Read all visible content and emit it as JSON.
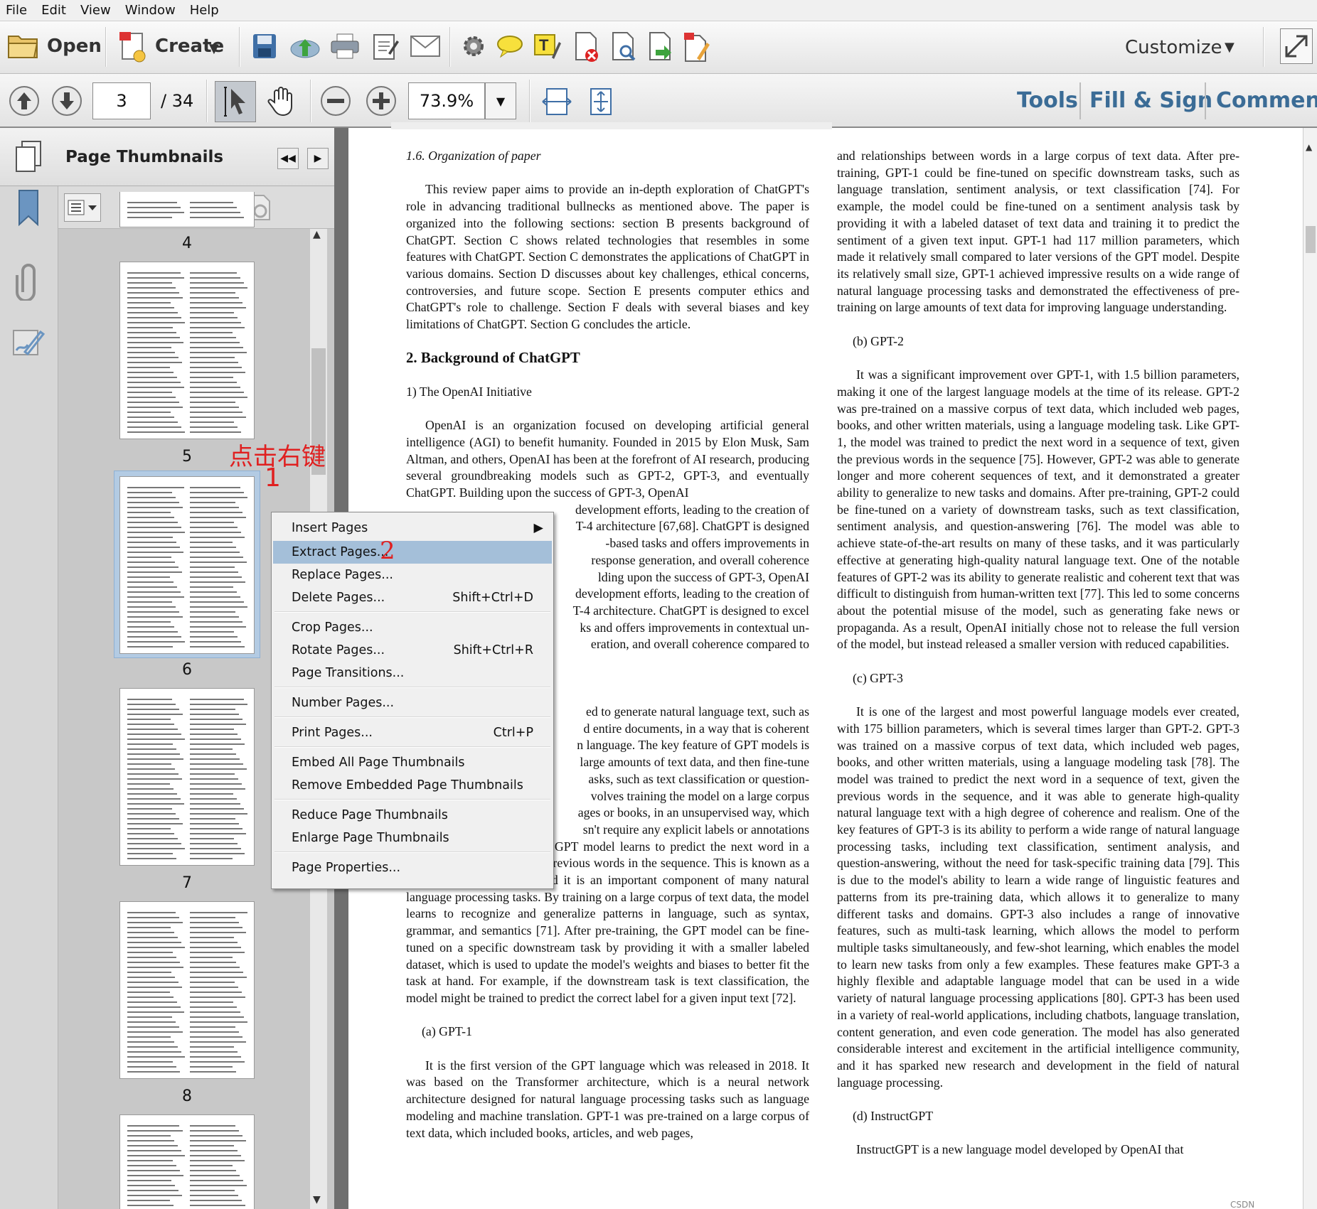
{
  "menubar": [
    "File",
    "Edit",
    "View",
    "Window",
    "Help"
  ],
  "toolbar": {
    "open": "Open",
    "create": "Create",
    "customize": "Customize"
  },
  "nav": {
    "page": "3",
    "total": "/ 34",
    "zoom": "73.9%"
  },
  "right_tabs": {
    "tools": "Tools",
    "fill": "Fill & Sign",
    "comment": "Comment"
  },
  "panel": {
    "title": "Page Thumbnails"
  },
  "thumbs": {
    "p4": "4",
    "p5": "5",
    "p6": "6",
    "p7": "7",
    "p8": "8"
  },
  "annot": {
    "a1": "点击右键",
    "a2": "1",
    "a3": "2"
  },
  "menu": {
    "insert": "Insert Pages",
    "extract": "Extract Pages...",
    "replace": "Replace Pages...",
    "delete": "Delete Pages...",
    "delete_sc": "Shift+Ctrl+D",
    "crop": "Crop Pages...",
    "rotate": "Rotate Pages...",
    "rotate_sc": "Shift+Ctrl+R",
    "trans": "Page Transitions...",
    "number": "Number Pages...",
    "print": "Print Pages...",
    "print_sc": "Ctrl+P",
    "embed": "Embed All Page Thumbnails",
    "remove": "Remove Embedded Page Thumbnails",
    "reduce": "Reduce Page Thumbnails",
    "enlarge": "Enlarge Page Thumbnails",
    "props": "Page Properties..."
  },
  "doc": {
    "l_h16": "1.6.  Organization of paper",
    "l_p1": "This review paper aims to provide an in-depth exploration of ChatGPT's role in advancing traditional bullnecks as mentioned above. The paper is organized into the following sections: section B presents background of ChatGPT. Section C shows related technologies that resembles in some features with ChatGPT. Section C demonstrates the applications of ChatGPT in various domains. Section D discusses about key challenges, ethical concerns, controversies, and future scope. Section E presents computer ethics and ChatGPT's role to challenge. Section F deals with several biases and key limitations of ChatGPT. Section G concludes the article.",
    "l_h2": "2.  Background of ChatGPT",
    "l_h21": "1) The OpenAI Initiative",
    "l_p2a": "OpenAI is an organization focused on developing artificial general intelligence (AGI) to benefit humanity. Founded in 2015 by Elon Musk, Sam Altman, and others, OpenAI has been at the forefront of AI research, producing several groundbreaking models such as GPT-2, GPT-3, and eventually ChatGPT. Building upon the success of GPT-3, OpenAI",
    "l_p2b": "development efforts, leading to the creation of",
    "l_p2c": "T-4 architecture [67,68]. ChatGPT is designed",
    "l_p2d": "-based tasks and offers improvements in",
    "l_p2e": "response generation, and overall coherence",
    "l_p2f": "lding upon the success of GPT-3, OpenAI",
    "l_p2g": "development efforts, leading to the creation of",
    "l_p2h": "T-4 architecture. ChatGPT is designed to excel",
    "l_p2i": "ks and offers improvements in contextual un-",
    "l_p2j": "eration, and overall coherence compared to",
    "l_p3a": "ed to generate natural language text, such as",
    "l_p3b": "d entire documents, in a way that is coherent",
    "l_p3c": "n language. The key feature of GPT models is",
    "l_p3d": "large amounts of text data, and then fine-tune",
    "l_p3e": "asks, such as text classification or question-",
    "l_p3f": "volves training the model on a large corpus",
    "l_p3g": "ages or books, in an unsupervised way, which",
    "l_p3h": "sn't require any explicit labels or annotations",
    "l_p4": "During pre-training, the GPT model learns to predict the next word in a sequence of text, given the previous words in the sequence. This is known as a language modeling task, and it is an important component of many natural language processing tasks. By training on a large corpus of text data, the model learns to recognize and generalize patterns in language, such as syntax, grammar, and semantics [71]. After pre-training, the GPT model can be fine-tuned on a specific downstream task by providing it with a smaller labeled dataset, which is used to update the model's weights and biases to better fit the task at hand. For example, if the downstream task is text classification, the model might be trained to predict the correct label for a given input text [72].",
    "l_ha": "(a)  GPT-1",
    "l_p5": "It is the first version of the GPT language which was released in 2018. It was based on the Transformer architecture, which is a neural network architecture designed for natural language processing tasks such as language modeling and machine translation. GPT-1 was pre-trained on a large corpus of text data, which included books, articles, and web pages,",
    "r_p1": "and relationships between words in a large corpus of text data. After pre-training, GPT-1 could be fine-tuned on specific downstream tasks, such as language translation, sentiment analysis, or text classification [74]. For example, the model could be fine-tuned on a sentiment analysis task by providing it with a labeled dataset of text data and training it to predict the sentiment of a given text input. GPT-1 had 117 million parameters, which made it relatively small compared to later versions of the GPT model. Despite its relatively small size, GPT-1 achieved impressive results on a wide range of natural language processing tasks and demonstrated the effectiveness of pre-training on large amounts of text data for improving language understanding.",
    "r_hb": "(b)  GPT-2",
    "r_p2": "It was a significant improvement over GPT-1, with 1.5 billion parameters, making it one of the largest language models at the time of its release. GPT-2 was pre-trained on a massive corpus of text data, which included web pages, books, and other written materials, using a language modeling task. Like GPT-1, the model was trained to predict the next word in a sequence of text, given the previous words in the sequence [75]. However, GPT-2 was able to generate longer and more coherent sequences of text, and it demonstrated a greater ability to generalize to new tasks and domains. After pre-training, GPT-2 could be fine-tuned on a variety of downstream tasks, such as text classification, sentiment analysis, and question-answering [76]. The model was able to achieve state-of-the-art results on many of these tasks, and it was particularly effective at generating high-quality natural language text. One of the notable features of GPT-2 was its ability to generate realistic and coherent text that was difficult to distinguish from human-written text [77]. This led to some concerns about the potential misuse of the model, such as generating fake news or propaganda. As a result, OpenAI initially chose not to release the full version of the model, but instead released a smaller version with reduced capabilities.",
    "r_hc": "(c)  GPT-3",
    "r_p3": "It is one of the largest and most powerful language models ever created, with 175 billion parameters, which is several times larger than GPT-2. GPT-3 was trained on a massive corpus of text data, which included web pages, books, and other written materials, using a language modeling task [78]. The model was trained to predict the next word in a sequence of text, given the previous words in the sequence, and it was able to generate high-quality natural language text with a high degree of coherence and realism. One of the key features of GPT-3 is its ability to perform a wide range of natural language processing tasks, including text classification, sentiment analysis, and question-answering, without the need for task-specific training data [79]. This is due to the model's ability to learn a wide range of linguistic features and patterns from its pre-training data, which allows it to generalize to many different tasks and domains. GPT-3 also includes a range of innovative features, such as multi-task learning, which allows the model to perform multiple tasks simultaneously, and few-shot learning, which enables the model to learn new tasks from only a few examples. These features make GPT-3 a highly flexible and adaptable language model that can be used in a wide variety of natural language processing applications [80]. GPT-3 has been used in a variety of real-world applications, including chatbots, language translation, content generation, and even code generation. The model has also generated considerable interest and excitement in the artificial intelligence community, and it has sparked new research and development in the field of natural language processing.",
    "r_hd": "(d)  InstructGPT",
    "r_p4": "InstructGPT is a new language model developed by OpenAI that",
    "watermark": "CSDN @Xminyang"
  }
}
